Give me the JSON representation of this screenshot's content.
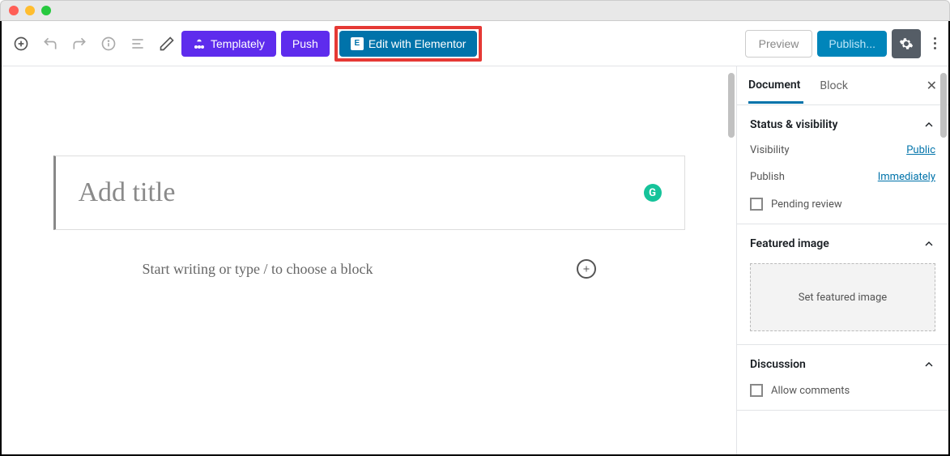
{
  "toolbar": {
    "templately_label": "Templately",
    "push_label": "Push",
    "elementor_label": "Edit with Elementor",
    "preview_label": "Preview",
    "publish_label": "Publish..."
  },
  "editor": {
    "title_placeholder": "Add title",
    "prompt_text": "Start writing or type / to choose a block",
    "grammarly_glyph": "G"
  },
  "sidebar": {
    "tabs": {
      "document": "Document",
      "block": "Block"
    },
    "panels": {
      "status": {
        "heading": "Status & visibility",
        "visibility_label": "Visibility",
        "visibility_value": "Public",
        "publish_label": "Publish",
        "publish_value": "Immediately",
        "pending_label": "Pending review"
      },
      "featured": {
        "heading": "Featured image",
        "set_label": "Set featured image"
      },
      "discussion": {
        "heading": "Discussion",
        "allow_label": "Allow comments"
      }
    }
  }
}
